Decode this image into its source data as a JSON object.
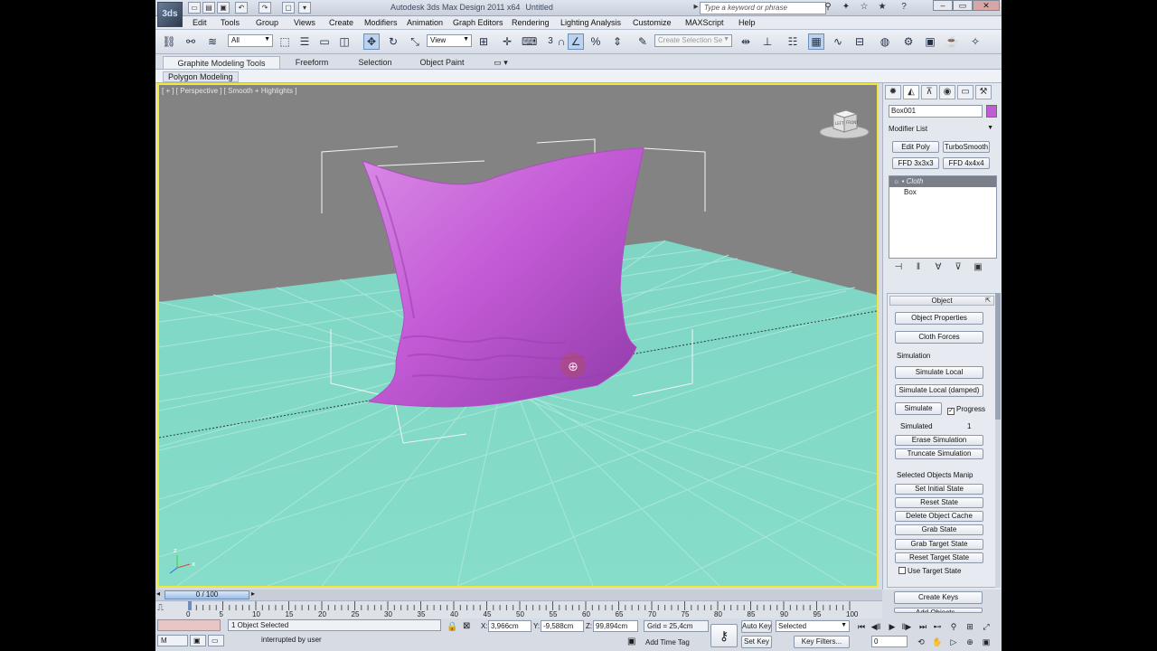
{
  "titlebar": {
    "app_logo": "3ds",
    "app_title": "Autodesk 3ds Max Design 2011 x64",
    "file_name": "Untitled",
    "search_placeholder": "Type a keyword or phrase"
  },
  "menu": [
    "Edit",
    "Tools",
    "Group",
    "Views",
    "Create",
    "Modifiers",
    "Animation",
    "Graph Editors",
    "Rendering",
    "Lighting Analysis",
    "Customize",
    "MAXScript",
    "Help"
  ],
  "toolbar": {
    "selection_filter": "All",
    "ref_coord": "View",
    "named_selection_placeholder": "Create Selection Se",
    "snap_label": "3"
  },
  "ribbon": {
    "tabs": [
      "Graphite Modeling Tools",
      "Freeform",
      "Selection",
      "Object Paint"
    ],
    "panel_label": "Polygon Modeling"
  },
  "viewport": {
    "label": "[ + ] [ Perspective ] [ Smooth + Highlights ]",
    "grid_color": "#7fd6c4",
    "object_color": "#c45bd6",
    "viewcube_labels": [
      "LEFT",
      "FRONT"
    ]
  },
  "command_panel": {
    "object_name": "Box001",
    "object_color": "#c45bd6",
    "modifier_list_label": "Modifier List",
    "modifier_buttons": [
      "Edit Poly",
      "TurboSmooth",
      "FFD 3x3x3",
      "FFD 4x4x4"
    ],
    "stack": [
      "Cloth",
      "Box"
    ],
    "rollout": {
      "title": "Object",
      "object_properties": "Object Properties",
      "cloth_forces": "Cloth Forces",
      "simulation_label": "Simulation",
      "simulate_local": "Simulate Local",
      "simulate_local_damped": "Simulate Local (damped)",
      "simulate": "Simulate",
      "progress": "Progress",
      "simulated_label": "Simulated",
      "simulated_value": "1",
      "erase_simulation": "Erase Simulation",
      "truncate_simulation": "Truncate Simulation",
      "selected_objects_label": "Selected Objects Manip",
      "set_initial_state": "Set Initial State",
      "reset_state": "Reset State",
      "delete_object_cache": "Delete Object Cache",
      "grab_state": "Grab State",
      "grab_target_state": "Grab Target State",
      "reset_target_state": "Reset Target State",
      "use_target_state": "Use Target State",
      "create_keys": "Create Keys",
      "add_objects": "Add Objects..."
    }
  },
  "timeline": {
    "slider_label": "0 / 100",
    "frame_current": 0,
    "frame_total": 100,
    "ticks": [
      "0",
      "5",
      "10",
      "15",
      "20",
      "25",
      "30",
      "35",
      "40",
      "45",
      "50",
      "55",
      "60",
      "65",
      "70",
      "75",
      "80",
      "85",
      "90",
      "95",
      "100"
    ]
  },
  "status": {
    "maxscript_mini": "M",
    "selection_status": "1 Object Selected",
    "prompt": "interrupted by user",
    "x_label": "X:",
    "x_value": "3,966cm",
    "y_label": "Y:",
    "y_value": "-9,588cm",
    "z_label": "Z:",
    "z_value": "99,894cm",
    "grid": "Grid = 25,4cm",
    "add_time_tag": "Add Time Tag",
    "auto_key": "Auto Key",
    "set_key": "Set Key",
    "key_filter_select": "Selected",
    "key_filters": "Key Filters...",
    "current_frame": "0"
  }
}
